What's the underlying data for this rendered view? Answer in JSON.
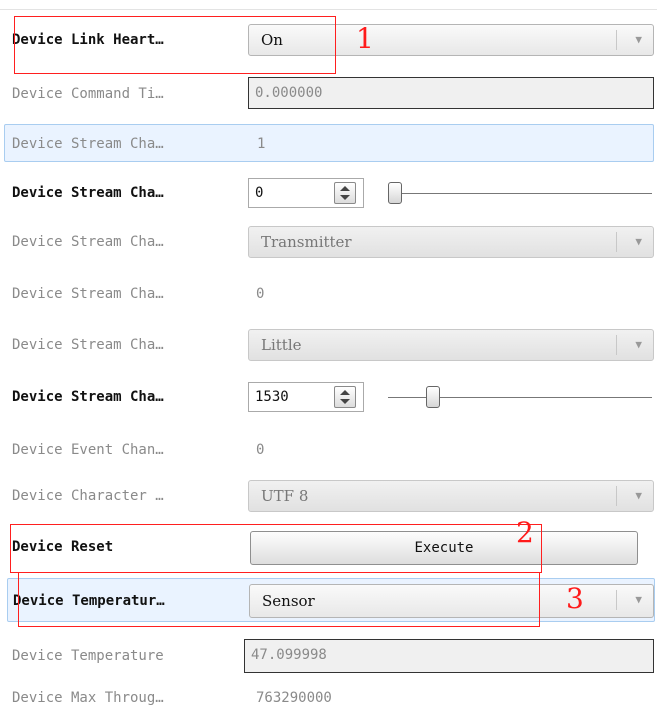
{
  "rows": {
    "link_heartbeat": {
      "label": "Device Link Heart…",
      "value": "On"
    },
    "command_timeout": {
      "label": "Device Command Ti…",
      "value": "0.000000"
    },
    "stream_count": {
      "label": "Device Stream Cha…",
      "value": "1"
    },
    "stream_selector": {
      "label": "Device Stream Cha…",
      "value": "0",
      "slider_fraction": 0.0
    },
    "stream_type": {
      "label": "Device Stream Cha…",
      "value": "Transmitter"
    },
    "stream_link": {
      "label": "Device Stream Cha…",
      "value": "0"
    },
    "stream_endianness": {
      "label": "Device Stream Cha…",
      "value": "Little"
    },
    "stream_packet_size": {
      "label": "Device Stream Cha…",
      "value": "1530",
      "slider_fraction": 0.15
    },
    "event_channel": {
      "label": "Device Event Chan…",
      "value": "0"
    },
    "character_set": {
      "label": "Device Character …",
      "value": "UTF 8"
    },
    "reset": {
      "label": "Device Reset",
      "button": "Execute"
    },
    "temperature_selector": {
      "label": "Device Temperatur…",
      "value": "Sensor"
    },
    "temperature": {
      "label": "Device Temperature",
      "value": "47.099998"
    },
    "max_throughput": {
      "label": "Device Max Throug…",
      "value": "763290000"
    }
  },
  "annotations": [
    "1",
    "2",
    "3"
  ],
  "colors": {
    "annotation": "#ff1f1f",
    "highlight": "#eaf3ff",
    "highlight_border": "#a9cdf0"
  }
}
